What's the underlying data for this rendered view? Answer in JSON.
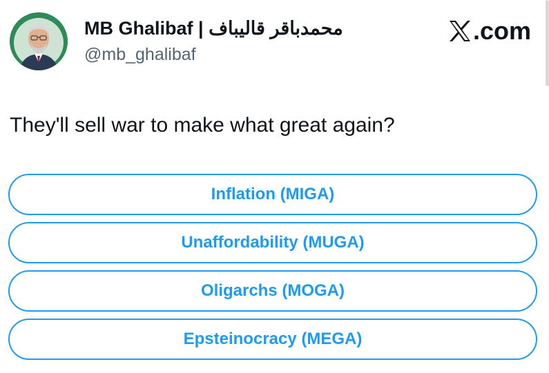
{
  "author": {
    "display_name": "MB Ghalibaf | محمدباقر قالیباف",
    "handle": "@mb_ghalibaf"
  },
  "brand": {
    "site_suffix": ".com",
    "icon": "x-logo-icon"
  },
  "tweet": {
    "text": "They'll sell war to make what great again?"
  },
  "poll": {
    "options": [
      {
        "label": "Inflation (MIGA)"
      },
      {
        "label": "Unaffordability (MUGA)"
      },
      {
        "label": "Oligarchs (MOGA)"
      },
      {
        "label": "Epsteinocracy (MEGA)"
      }
    ]
  },
  "colors": {
    "accent": "#1d9bf0",
    "text": "#0f1419",
    "secondary_text": "#536471",
    "avatar_ring": "#2e8b57"
  }
}
